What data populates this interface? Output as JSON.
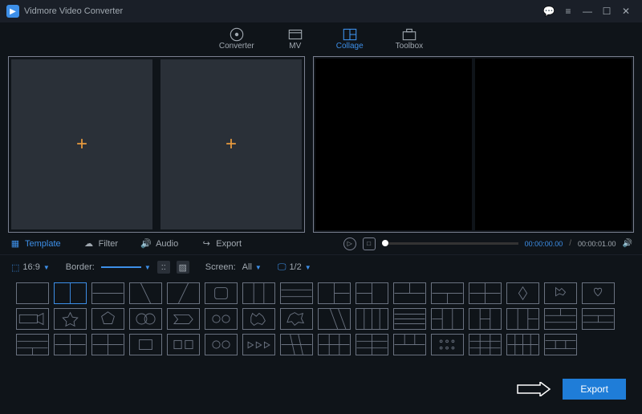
{
  "app": {
    "title": "Vidmore Video Converter"
  },
  "topnav": [
    {
      "label": "Converter"
    },
    {
      "label": "MV"
    },
    {
      "label": "Collage"
    },
    {
      "label": "Toolbox"
    }
  ],
  "tabs": {
    "template": "Template",
    "filter": "Filter",
    "audio": "Audio",
    "export": "Export"
  },
  "player": {
    "current_time": "00:00:00.00",
    "duration": "00:00:01.00"
  },
  "options": {
    "aspect_label": "16:9",
    "border_label": "Border:",
    "screen_label": "Screen:",
    "screen_value": "All",
    "page": "1/2"
  },
  "footer": {
    "export_label": "Export"
  }
}
